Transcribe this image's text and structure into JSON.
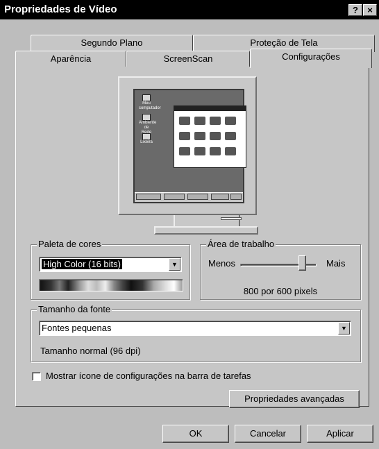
{
  "window": {
    "title": "Propriedades de Vídeo",
    "help_label": "?",
    "close_label": "×"
  },
  "tabs": {
    "back_row": [
      "Segundo Plano",
      "Proteção de Tela"
    ],
    "front_row": [
      "Aparência",
      "ScreenScan",
      "Configurações"
    ],
    "active": "Configurações"
  },
  "preview": {
    "desktop_icons": [
      "Meu computador",
      "Ambiente de Rede",
      "Lixeira"
    ],
    "window_icons": 12
  },
  "palette": {
    "legend": "Paleta de cores",
    "selected": "High Color (16 bits)"
  },
  "desktop_area": {
    "legend": "Área de trabalho",
    "min_label": "Menos",
    "max_label": "Mais",
    "resolution": "800 por 600 pixels",
    "level": 0.85
  },
  "font_size": {
    "legend": "Tamanho da fonte",
    "selected": "Fontes pequenas",
    "description": "Tamanho normal (96 dpi)"
  },
  "taskbar_checkbox": {
    "label": "Mostrar ícone de configurações na barra de tarefas",
    "checked": false
  },
  "buttons": {
    "advanced": "Propriedades avançadas",
    "ok": "OK",
    "cancel": "Cancelar",
    "apply": "Aplicar"
  }
}
